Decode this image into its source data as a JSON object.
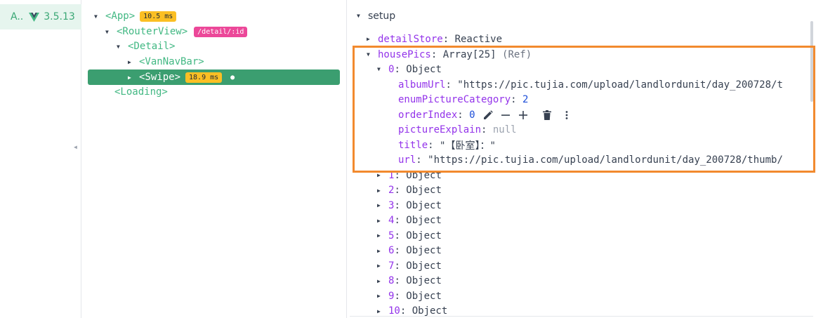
{
  "app_sidebar": {
    "app_abbr": "A..",
    "version": "3.5.13"
  },
  "component_tree": {
    "app": {
      "label": "<App>",
      "time": "10.5 ms"
    },
    "router_view": {
      "label": "<RouterView>",
      "route": "/detail/:id"
    },
    "detail": {
      "label": "<Detail>"
    },
    "van_nav_bar": {
      "label": "<VanNavBar>"
    },
    "swipe": {
      "label": "<Swipe>",
      "time": "18.9 ms"
    },
    "loading": {
      "label": "<Loading>"
    }
  },
  "inspector": {
    "section_title": "setup",
    "detail_store": {
      "key": "detailStore",
      "value": "Reactive"
    },
    "house_pics": {
      "key": "housePics",
      "value": "Array[25]",
      "ref": "(Ref)"
    },
    "item0": {
      "index": "0",
      "type": "Object",
      "fields": {
        "album_url": {
          "key": "albumUrl",
          "value": "\"https://pic.tujia.com/upload/landlordunit/day_200728/t"
        },
        "enum_picture_category": {
          "key": "enumPictureCategory",
          "value": "2"
        },
        "order_index": {
          "key": "orderIndex",
          "value": "0"
        },
        "picture_explain": {
          "key": "pictureExplain",
          "value": "null"
        },
        "title": {
          "key": "title",
          "value": "\"【卧室】：\""
        },
        "url": {
          "key": "url",
          "value": "\"https://pic.tujia.com/upload/landlordunit/day_200728/thumb/"
        }
      }
    },
    "items": [
      {
        "index": "1",
        "type": "Object"
      },
      {
        "index": "2",
        "type": "Object"
      },
      {
        "index": "3",
        "type": "Object"
      },
      {
        "index": "4",
        "type": "Object"
      },
      {
        "index": "5",
        "type": "Object"
      },
      {
        "index": "6",
        "type": "Object"
      },
      {
        "index": "7",
        "type": "Object"
      },
      {
        "index": "8",
        "type": "Object"
      },
      {
        "index": "9",
        "type": "Object"
      },
      {
        "index": "10",
        "type": "Object"
      }
    ]
  },
  "colors": {
    "vue_green": "#42b883",
    "selected_bg": "#3b9e70",
    "time_badge": "#fbbf24",
    "route_badge": "#ec4899",
    "key_purple": "#9333ea",
    "number_blue": "#1d4ed8",
    "highlight_orange": "#f28a2e"
  },
  "icons": [
    "vue-logo-icon",
    "collapse-triangle-icon",
    "expand-triangle-icon",
    "pencil-icon",
    "minus-icon",
    "plus-icon",
    "trash-icon",
    "more-vertical-icon",
    "chevron-left-icon"
  ]
}
